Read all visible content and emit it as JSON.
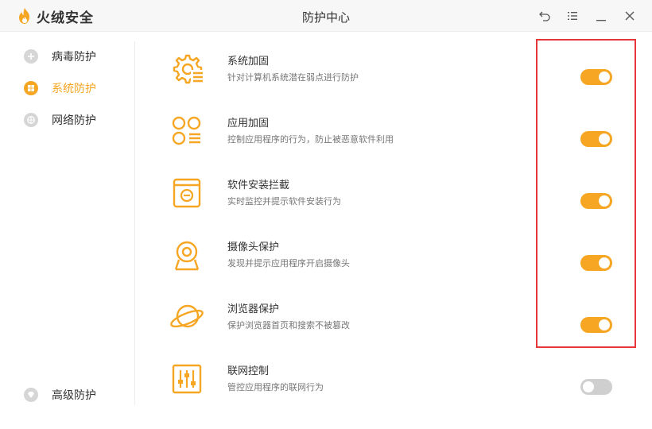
{
  "app": {
    "name": "火绒安全",
    "window_title": "防护中心",
    "brand_color": "#f6a623"
  },
  "window_controls": [
    {
      "name": "back-icon"
    },
    {
      "name": "menu-icon"
    },
    {
      "name": "minimize-icon"
    },
    {
      "name": "close-icon"
    }
  ],
  "sidebar": {
    "items": [
      {
        "label": "病毒防护",
        "icon": "virus-shield-icon",
        "active": false
      },
      {
        "label": "系统防护",
        "icon": "windows-icon",
        "active": true
      },
      {
        "label": "网络防护",
        "icon": "network-icon",
        "active": false
      }
    ],
    "bottom_item": {
      "label": "高级防护",
      "icon": "diamond-icon"
    }
  },
  "features": [
    {
      "title": "系统加固",
      "desc": "针对计算机系统潜在弱点进行防护",
      "icon": "system-gear-icon",
      "enabled": true
    },
    {
      "title": "应用加固",
      "desc": "控制应用程序的行为，防止被恶意软件利用",
      "icon": "app-grid-icon",
      "enabled": true
    },
    {
      "title": "软件安装拦截",
      "desc": "实时监控并提示软件安装行为",
      "icon": "install-box-icon",
      "enabled": true
    },
    {
      "title": "摄像头保护",
      "desc": "发现并提示应用程序开启摄像头",
      "icon": "webcam-icon",
      "enabled": true
    },
    {
      "title": "浏览器保护",
      "desc": "保护浏览器首页和搜索不被篡改",
      "icon": "planet-icon",
      "enabled": true
    },
    {
      "title": "联网控制",
      "desc": "管控应用程序的联网行为",
      "icon": "sliders-icon",
      "enabled": false
    }
  ]
}
